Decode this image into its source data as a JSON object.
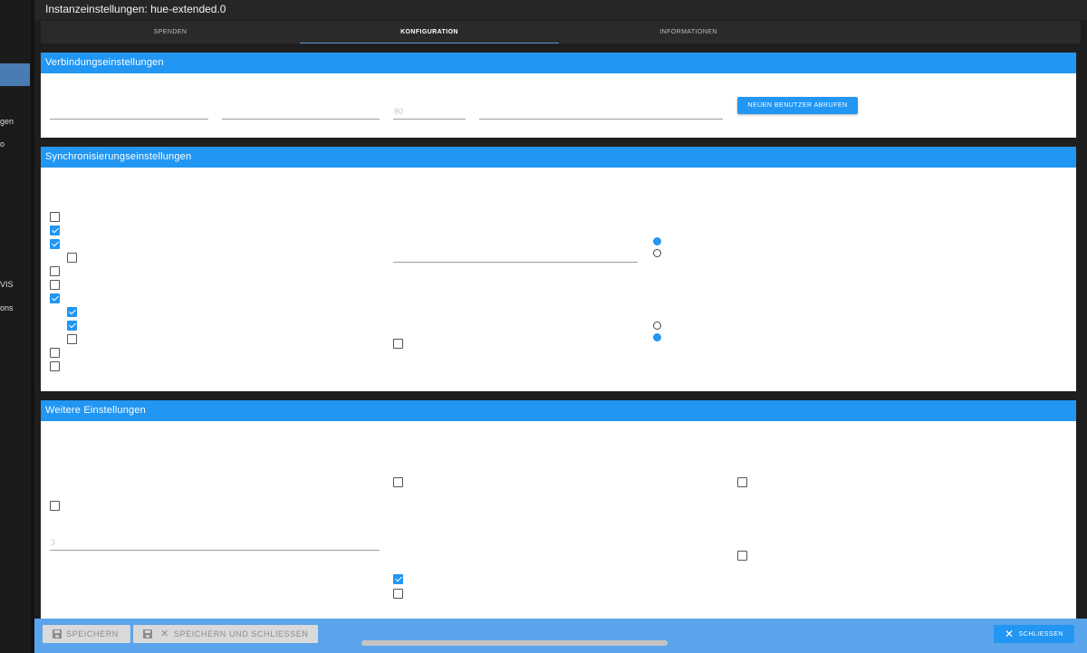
{
  "leftnav": {
    "fragments": [
      "gen",
      "o",
      "VIS",
      "ons"
    ]
  },
  "dialog": {
    "title": "Instanzeinstellungen: hue-extended.0",
    "tabs": [
      {
        "label": "SPENDEN"
      },
      {
        "label": "KONFIGURATION"
      },
      {
        "label": "INFORMATIONEN"
      }
    ]
  },
  "connection": {
    "header": "Verbindungseinstellungen",
    "port_placeholder": "80",
    "get_user_button": "NEUEN BENUTZER ABRUFEN"
  },
  "sync": {
    "header": "Synchronisierungseinstellungen"
  },
  "further": {
    "header": "Weitere Einstellungen",
    "number_placeholder": "3"
  },
  "bottom": {
    "save_label": "SPEICHERN",
    "save_close_label": "SPEICHERN UND SCHLIESSEN",
    "close_label": "SCHLIESSEN"
  },
  "colors": {
    "accent": "#2196f3",
    "bottom_bar": "#5aa4eb"
  }
}
